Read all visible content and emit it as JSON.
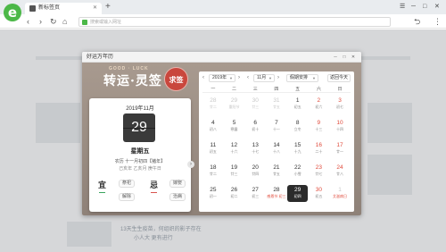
{
  "browser": {
    "logo": "e",
    "tab_title": "新标签页",
    "tab_close": "✕",
    "new_tab": "+",
    "address_placeholder": "搜索或输入网址",
    "win_controls": [
      "☰",
      "─",
      "□",
      "✕"
    ]
  },
  "nav": {
    "back": "‹",
    "forward": "›",
    "reload": "↻",
    "home": "⌂",
    "undo": "⮌",
    "menu": "⋮"
  },
  "background_page": {
    "text_1": "13天生生疫苗，何组织的影子存在",
    "text_2": "小人大 更有进行"
  },
  "dialog": {
    "title": "好运万年历",
    "btn_min": "─",
    "btn_max": "□",
    "btn_close": "✕",
    "banner_top": "GOOD · LUCK",
    "banner_title": "转运·灵签",
    "qiuqian": "求签"
  },
  "day_card": {
    "year_month": "2019年11月",
    "day": "29",
    "weekday": "星期五",
    "lunar": "农历 十一月初四【猪年】",
    "ganzhi": "己亥年 乙亥月 庚午日",
    "yi": "宜",
    "ji": "忌",
    "yi_items": [
      "祭祀",
      "解除"
    ],
    "ji_items": [
      "嫁娶",
      "治病"
    ],
    "side_arrow": "›"
  },
  "month_panel": {
    "prev": "‹",
    "next": "›",
    "year": "2019年",
    "month": "11月",
    "holiday": "假期安排",
    "today": "返回今天",
    "weekdays": [
      "一",
      "二",
      "三",
      "四",
      "五",
      "六",
      "日"
    ],
    "rows": [
      [
        {
          "d": "28",
          "s": "廿二",
          "out": true
        },
        {
          "d": "29",
          "s": "重阳节",
          "out": true
        },
        {
          "d": "30",
          "s": "廿三",
          "out": true
        },
        {
          "d": "31",
          "s": "廿五",
          "out": true
        },
        {
          "d": "1",
          "s": "初五"
        },
        {
          "d": "2",
          "s": "初六",
          "we": true
        },
        {
          "d": "3",
          "s": "初七",
          "we": true
        }
      ],
      [
        {
          "d": "4",
          "s": "初八"
        },
        {
          "d": "5",
          "s": "寒露"
        },
        {
          "d": "6",
          "s": "初十"
        },
        {
          "d": "7",
          "s": "十一"
        },
        {
          "d": "8",
          "s": "立冬"
        },
        {
          "d": "9",
          "s": "十三",
          "we": true
        },
        {
          "d": "10",
          "s": "十四",
          "we": true
        }
      ],
      [
        {
          "d": "11",
          "s": "初五"
        },
        {
          "d": "12",
          "s": "十六"
        },
        {
          "d": "13",
          "s": "十七"
        },
        {
          "d": "14",
          "s": "十八"
        },
        {
          "d": "15",
          "s": "十九"
        },
        {
          "d": "16",
          "s": "二十",
          "we": true
        },
        {
          "d": "17",
          "s": "廿一",
          "we": true
        }
      ],
      [
        {
          "d": "18",
          "s": "廿二"
        },
        {
          "d": "19",
          "s": "廿三"
        },
        {
          "d": "20",
          "s": "廿四"
        },
        {
          "d": "21",
          "s": "廿五"
        },
        {
          "d": "22",
          "s": "小雪"
        },
        {
          "d": "23",
          "s": "廿七",
          "we": true
        },
        {
          "d": "24",
          "s": "廿八",
          "we": true
        }
      ],
      [
        {
          "d": "25",
          "s": "初一"
        },
        {
          "d": "26",
          "s": "初二"
        },
        {
          "d": "27",
          "s": "初三"
        },
        {
          "d": "28",
          "s": "感恩节 初三",
          "red": true
        },
        {
          "d": "29",
          "s": "初四",
          "today": true
        },
        {
          "d": "30",
          "s": "初五",
          "we": true
        },
        {
          "d": "1",
          "s": "艾滋病日",
          "out": true,
          "red": true
        }
      ]
    ]
  }
}
